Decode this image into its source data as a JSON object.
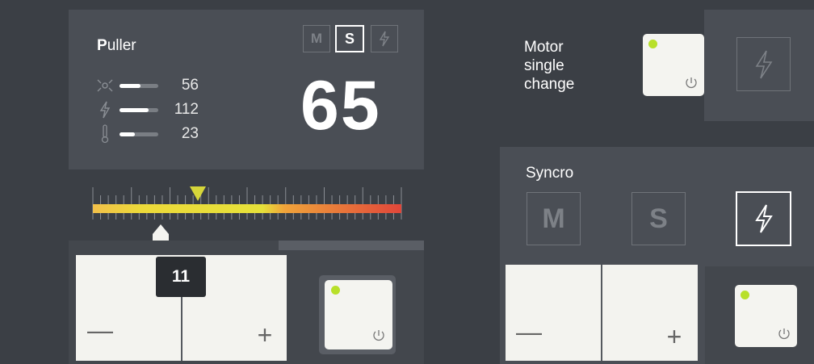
{
  "puller": {
    "title_first": "P",
    "title_rest": "uller",
    "modes": [
      {
        "label": "M",
        "active": false
      },
      {
        "label": "S",
        "active": true
      },
      {
        "label": "⚡",
        "active": false
      }
    ],
    "stats": [
      {
        "icon": "fan-icon",
        "value": "56",
        "level": 0.55
      },
      {
        "icon": "lightning-icon",
        "value": "112",
        "level": 0.75
      },
      {
        "icon": "thermometer-icon",
        "value": "23",
        "level": 0.4
      }
    ],
    "big_value": "65",
    "slider_value": "11",
    "setpoint_marker_value": 65,
    "slider_marker_value": 11
  },
  "motor_single_change": {
    "label_line1": "Motor",
    "label_line2": "single",
    "label_line3": "change"
  },
  "syncro": {
    "label": "Syncro",
    "modes": [
      {
        "label": "M",
        "active": false
      },
      {
        "label": "S",
        "active": false
      },
      {
        "label": "⚡",
        "active": true
      }
    ]
  },
  "stepper": {
    "minus": "—",
    "plus": "+"
  },
  "colors": {
    "led_on": "#b8e02a",
    "scale_low": "#f2b43a",
    "scale_mid": "#e8dd3a",
    "scale_high": "#e04a3a",
    "marker": "#d8d83a"
  }
}
